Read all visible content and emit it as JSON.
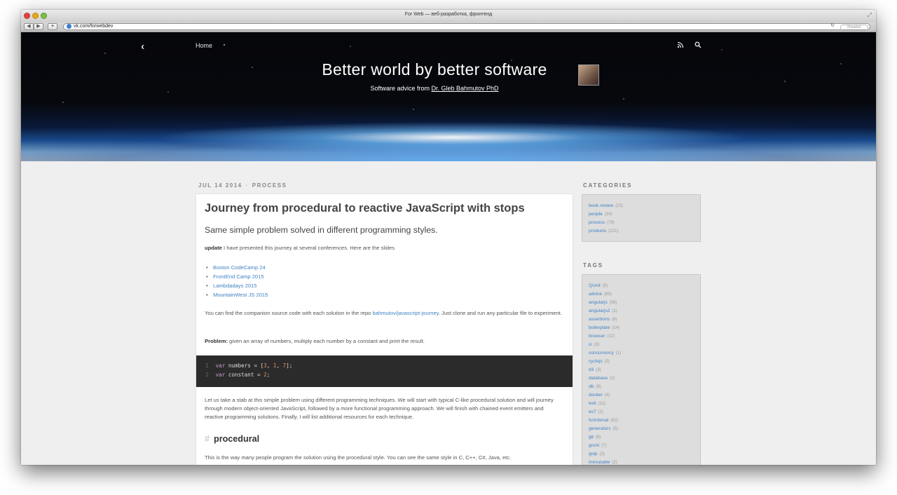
{
  "window": {
    "title": "For Web — веб-разработка, фронтенд",
    "url": "vk.com/forwebdev",
    "reader_label": "Reader",
    "plus_label": "+",
    "back_label": "◀",
    "forward_label": "▶"
  },
  "header": {
    "nav_home": "Home",
    "site_title": "Better world by better software",
    "subtitle_prefix": "Software advice from ",
    "author": "Dr. Gleb Bahmutov PhD"
  },
  "post": {
    "date": "JUL 14 2014",
    "separator": "·",
    "category": "PROCESS",
    "title": "Journey from procedural to reactive JavaScript with stops",
    "subtitle": "Same simple problem solved in different programming styles.",
    "update_label": "update",
    "update_text": " I have presented this journey at several conferences. Here are the slides",
    "slides": [
      "Boston CodeCamp 24",
      "FrontEnd Camp 2015",
      "Lambdadays 2015",
      "MountainWest JS 2015"
    ],
    "companion_text_1": "You can find the companion source code with each solution in the repo ",
    "companion_link": "bahmutov/javascript-journey",
    "companion_text_2": ". Just clone and run any particular file to experiment.",
    "problem_label": "Problem:",
    "problem_text": " given an array of numbers, multiply each number by a constant and print the result.",
    "code": [
      {
        "ln": "1",
        "kw": "var",
        "name": " numbers = [",
        "vals": [
          "3",
          "1",
          "7"
        ],
        "end": "];"
      },
      {
        "ln": "2",
        "kw": "var",
        "name": " constant = ",
        "vals": [
          "2"
        ],
        "end": ";"
      }
    ],
    "intro_paragraph": "Let us take a stab at this simple problem using different programming techniques. We will start with typical C-like procedural solution and will journey through modern object-oriented JavaScript, followed by a more functional programming approach. We will finish with chained event emitters and reactive programming solutions. Finally, I will list additional resources for each technique.",
    "section_hash": "#",
    "section_title": "procedural",
    "procedural_paragraph": "This is the way many people program the solution using the procedural style. You can see the same style in C, C++, C#, Java, etc."
  },
  "sidebar": {
    "categories_title": "CATEGORIES",
    "categories": [
      {
        "name": "book review",
        "count": "(15)"
      },
      {
        "name": "people",
        "count": "(34)"
      },
      {
        "name": "process",
        "count": "(79)"
      },
      {
        "name": "products",
        "count": "(221)"
      }
    ],
    "tags_title": "TAGS",
    "tags": [
      {
        "name": "QUnit",
        "count": "(5)"
      },
      {
        "name": "advice",
        "count": "(89)"
      },
      {
        "name": "angularjs",
        "count": "(58)"
      },
      {
        "name": "angularjs2",
        "count": "(1)"
      },
      {
        "name": "assertions",
        "count": "(8)"
      },
      {
        "name": "boilerplate",
        "count": "(14)"
      },
      {
        "name": "browser",
        "count": "(12)"
      },
      {
        "name": "ci",
        "count": "(3)"
      },
      {
        "name": "concurrency",
        "count": "(1)"
      },
      {
        "name": "cyclejs",
        "count": "(5)"
      },
      {
        "name": "d3",
        "count": "(3)"
      },
      {
        "name": "database",
        "count": "(2)"
      },
      {
        "name": "db",
        "count": "(6)"
      },
      {
        "name": "docker",
        "count": "(4)"
      },
      {
        "name": "es6",
        "count": "(11)"
      },
      {
        "name": "es7",
        "count": "(1)"
      },
      {
        "name": "functional",
        "count": "(52)"
      },
      {
        "name": "generators",
        "count": "(5)"
      },
      {
        "name": "git",
        "count": "(8)"
      },
      {
        "name": "grunt",
        "count": "(7)"
      },
      {
        "name": "gulp",
        "count": "(3)"
      },
      {
        "name": "immutable",
        "count": "(2)"
      }
    ]
  },
  "colors": {
    "link": "#4183c4",
    "code_bg": "#2b2b2b",
    "sidebar_box": "#dddddd"
  }
}
